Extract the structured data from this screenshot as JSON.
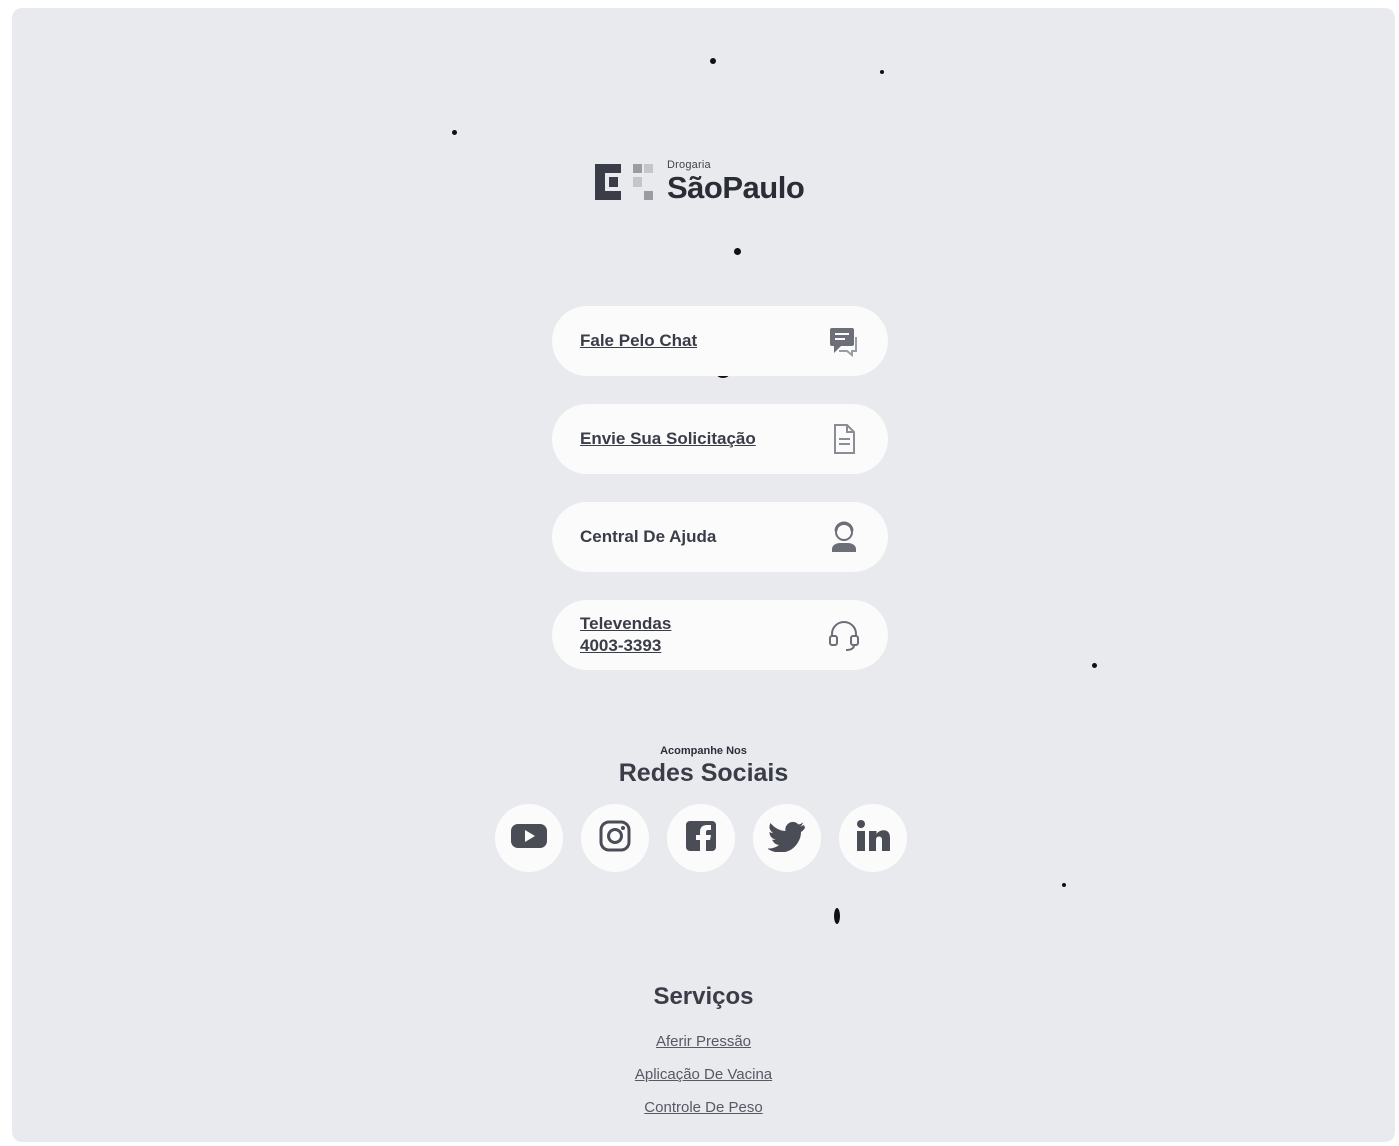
{
  "brand": {
    "kicker": "Drogaria",
    "name": "SãoPaulo"
  },
  "contact": [
    {
      "label": "Fale Pelo Chat",
      "icon": "chat-icon"
    },
    {
      "label": "Envie Sua Solicitação",
      "icon": "document-icon"
    },
    {
      "label": "Central De Ajuda",
      "icon": "help-agent-icon"
    },
    {
      "label": "Televendas\n4003-3393",
      "icon": "headset-icon"
    }
  ],
  "social": {
    "kicker": "Acompanhe Nos",
    "title": "Redes Sociais",
    "networks": [
      {
        "name": "youtube-icon"
      },
      {
        "name": "instagram-icon"
      },
      {
        "name": "facebook-icon"
      },
      {
        "name": "twitter-icon"
      },
      {
        "name": "linkedin-icon"
      }
    ]
  },
  "services": {
    "title": "Serviços",
    "links": [
      "Aferir Pressão",
      "Aplicação De Vacina",
      "Controle De Peso"
    ]
  },
  "colors": {
    "background": "#e9eaee",
    "card": "#fbfbfc",
    "text": "#3a3d47"
  }
}
